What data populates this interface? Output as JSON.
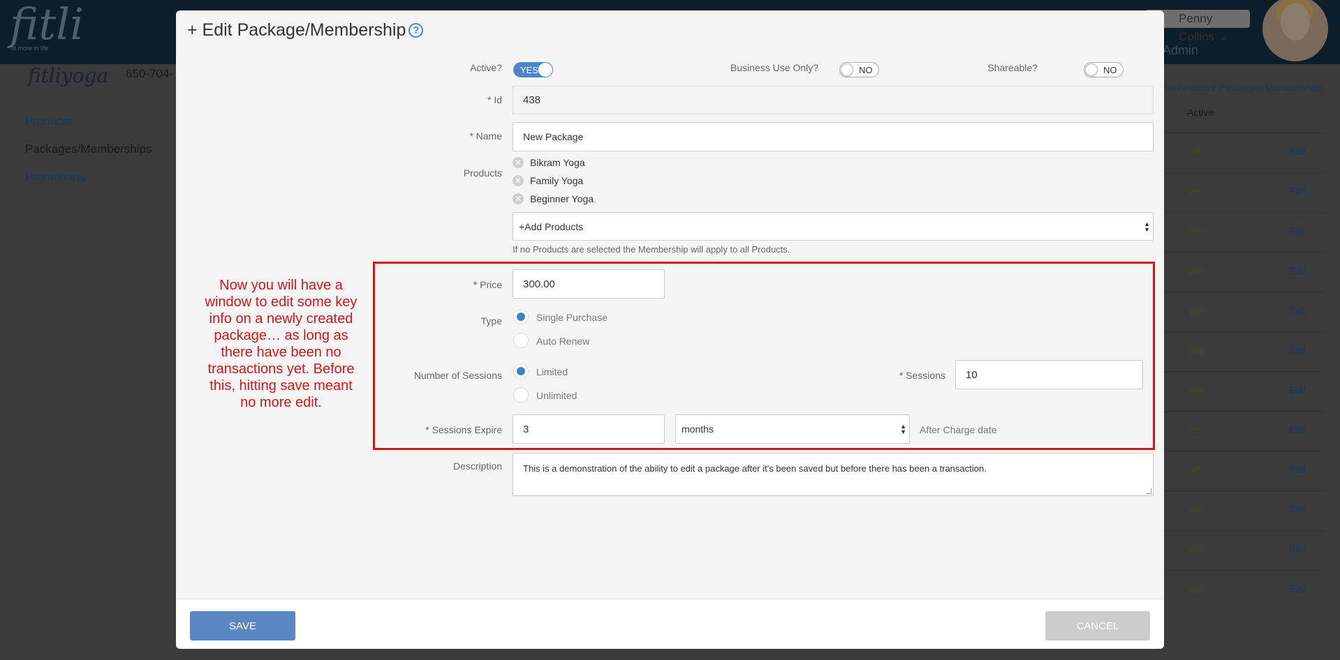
{
  "background": {
    "logo": "fitli",
    "logo_tagline": "fit more in life",
    "user_name": "Penny Collins",
    "user_chevron": "»",
    "admin_label": "Admin",
    "studio_logo": "fitliyoga",
    "phone": "650-704-",
    "nav": [
      "Products",
      "Packages/Memberships",
      "Promotions"
    ],
    "show_inactive_link": "how inactive Packages/Memberships",
    "active_column": "Active",
    "rows": [
      {
        "active": "yes",
        "action": "Edit"
      },
      {
        "active": "yes",
        "action": "Edit"
      },
      {
        "active": "yes",
        "action": "Edit"
      },
      {
        "active": "yes",
        "action": "Edit"
      },
      {
        "active": "yes",
        "action": "Edit"
      },
      {
        "active": "yes",
        "action": "Edit"
      },
      {
        "active": "yes",
        "action": "Edit"
      },
      {
        "active": "yes",
        "action": "Edit"
      },
      {
        "active": "yes",
        "action": "Edit"
      },
      {
        "active": "yes",
        "action": "Edit"
      },
      {
        "active": "yes",
        "action": "Edit"
      },
      {
        "active": "yes",
        "action": "Edit"
      }
    ]
  },
  "modal": {
    "title": "+ Edit Package/Membership",
    "help_icon": "?",
    "active": {
      "label": "Active?",
      "value": "YES"
    },
    "business_use": {
      "label": "Business Use Only?",
      "value": "NO"
    },
    "shareable": {
      "label": "Shareable?",
      "value": "NO"
    },
    "id": {
      "label": "* Id",
      "value": "438"
    },
    "name": {
      "label": "* Name",
      "value": "New Package"
    },
    "products": {
      "label": "Products",
      "items": [
        "Bikram Yoga",
        "Family Yoga",
        "Beginner Yoga"
      ],
      "add_label": "+Add Products",
      "hint": "If no Products are selected the Membership will apply to all Products."
    },
    "price": {
      "label": "* Price",
      "value": "300.00"
    },
    "type": {
      "label": "Type",
      "options": [
        "Single Purchase",
        "Auto Renew"
      ],
      "selected": "Single Purchase"
    },
    "number_of_sessions": {
      "label": "Number of Sessions",
      "options": [
        "Limited",
        "Unlimited"
      ],
      "selected": "Limited"
    },
    "sessions": {
      "label": "* Sessions",
      "value": "10"
    },
    "sessions_expire": {
      "label": "* Sessions Expire",
      "value": "3",
      "unit": "months",
      "suffix": "After Charge date"
    },
    "description": {
      "label": "Description",
      "value": "This is a demonstration of the ability to edit a package after it's been saved but before there has been a transaction."
    },
    "save_label": "SAVE",
    "cancel_label": "CANCEL"
  },
  "annotation": {
    "text": "Now you will have a window to edit some key info on a newly created package… as long as there have been no transactions yet.  Before this, hitting save meant no more edit."
  },
  "colors": {
    "accent": "#4a86c8",
    "save_button": "#5b86c4",
    "annotation": "#d61616"
  }
}
